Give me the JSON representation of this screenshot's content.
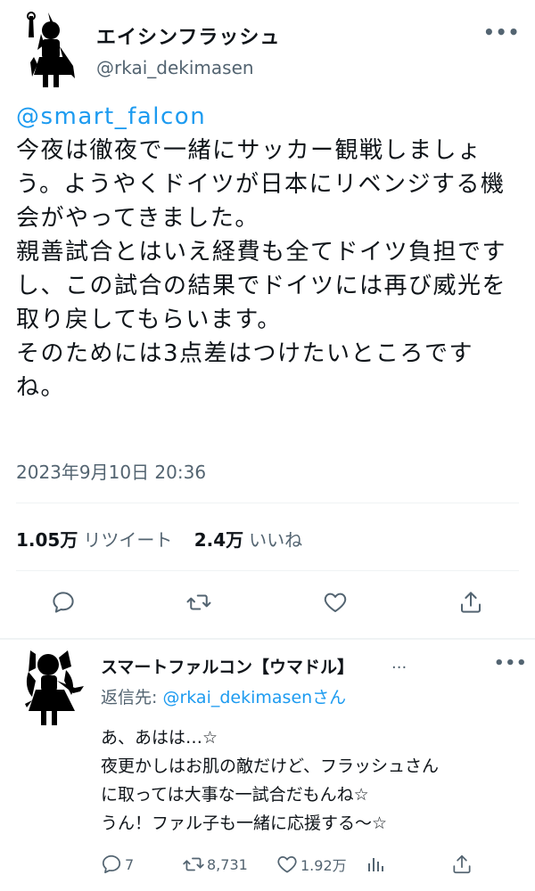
{
  "tweet": {
    "display_name": "エイシンフラッシュ",
    "handle": "@rkai_dekimasen",
    "more_label": "•••",
    "mention": "@smart_falcon",
    "body_lines": [
      "今夜は徹夜で一緒にサッカー観戦しましょ",
      "う。ようやくドイツが日本にリベンジする機",
      "会がやってきました。",
      "親善試合とはいえ経費も全てドイツ負担です",
      "し、この試合の結果でドイツには再び威光を",
      "取り戻してもらいます。",
      "そのためには3点差はつけたいところです",
      "ね。"
    ],
    "timestamp": "2023年9月10日 20:36",
    "stats": {
      "retweets_count": "1.05万",
      "retweets_label": "リツイート",
      "likes_count": "2.4万",
      "likes_label": "いいね"
    },
    "actions": [
      "reply-icon",
      "retweet-icon",
      "like-icon",
      "share-icon"
    ]
  },
  "reply": {
    "display_name": "スマートファルコン【ウマドル】",
    "name_ellipsis": "...",
    "more_label": "•••",
    "reply_to_prefix": "返信先: ",
    "reply_to_handle": "@rkai_dekimasen",
    "reply_to_suffix": "さん",
    "body_lines": [
      "あ、あはは…☆",
      "夜更かしはお肌の敵だけど、フラッシュさん",
      "に取っては大事な一試合だもんね☆",
      "うん！ファル子も一緒に応援する〜☆"
    ],
    "actions": {
      "replies": "7",
      "retweets": "8,731",
      "likes": "1.92万"
    }
  },
  "colors": {
    "accent": "#1d9bf0",
    "secondary_text": "#536471",
    "primary_text": "#0f1419",
    "divider": "#eff3f4"
  }
}
